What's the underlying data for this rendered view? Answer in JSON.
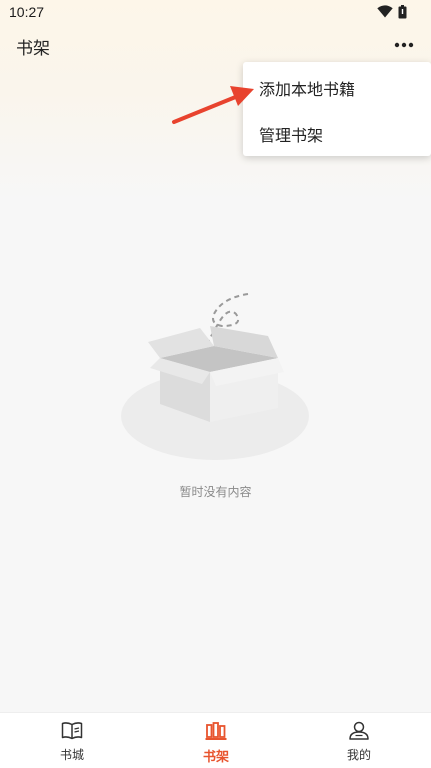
{
  "status_bar": {
    "time": "10:27"
  },
  "header": {
    "title": "书架"
  },
  "menu": {
    "items": [
      {
        "label": "添加本地书籍"
      },
      {
        "label": "管理书架"
      }
    ]
  },
  "empty_state": {
    "text": "暂时没有内容"
  },
  "tabs": [
    {
      "label": "书城",
      "icon": "book-icon"
    },
    {
      "label": "书架",
      "icon": "bookshelf-icon",
      "active": true
    },
    {
      "label": "我的",
      "icon": "profile-icon"
    }
  ],
  "colors": {
    "accent": "#e8542e",
    "arrow": "#e8432e"
  }
}
